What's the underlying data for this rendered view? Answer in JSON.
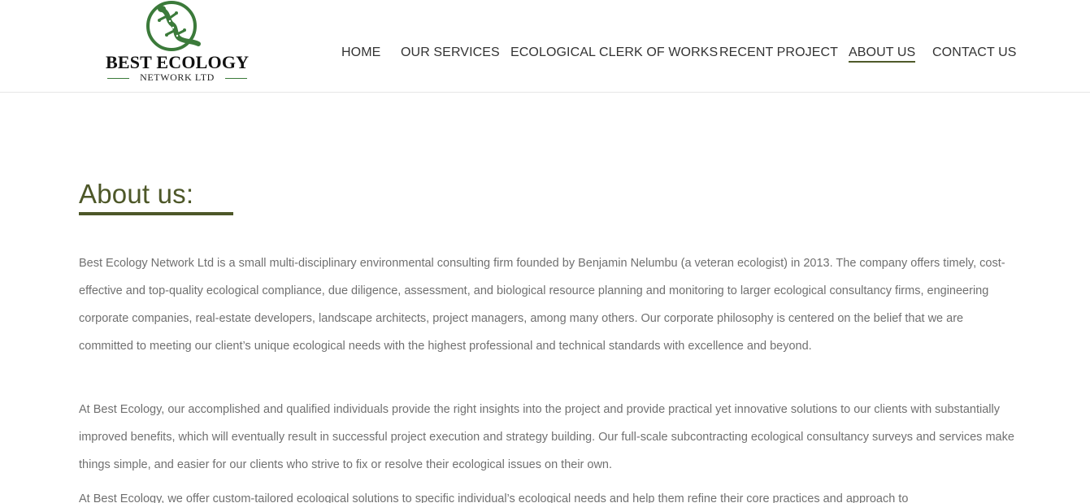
{
  "logo": {
    "title": "BEST ECOLOGY",
    "subtitle": "NETWORK LTD",
    "brand_green": "#3b7a3a"
  },
  "nav": {
    "items": [
      {
        "label": "HOME",
        "active": false
      },
      {
        "label": "OUR SERVICES",
        "active": false
      },
      {
        "label": "ECOLOGICAL CLERK OF WORKS",
        "active": false
      },
      {
        "label": "RECENT PROJECT",
        "active": false
      },
      {
        "label": "ABOUT US",
        "active": true
      },
      {
        "label": "CONTACT US",
        "active": false
      }
    ]
  },
  "main": {
    "heading": "About us:",
    "heading_color": "#4d5728",
    "paragraphs": [
      "Best Ecology Network Ltd is a small multi-disciplinary environmental consulting firm founded by Benjamin Nelumbu (a veteran ecologist) in 2013. The company offers timely, cost-effective and top-quality ecological compliance, due diligence, assessment, and biological resource planning and monitoring to larger ecological consultancy firms, engineering corporate companies, real-estate developers, landscape architects, project managers, among many others. Our corporate philosophy is centered on the belief that we are committed to meeting our client’s unique ecological needs with the highest professional and technical standards with excellence and beyond.",
      "At Best Ecology, our accomplished and qualified individuals provide the right insights into the project and provide practical yet innovative solutions to our clients with substantially improved benefits, which will eventually result in successful project execution and strategy building. Our full-scale subcontracting ecological consultancy surveys and services make things simple, and easier for our clients who strive to fix or resolve their ecological issues on their own.",
      "At Best Ecology, we offer custom-tailored ecological solutions to specific individual’s ecological needs and help them refine their core practices and approach to"
    ]
  }
}
